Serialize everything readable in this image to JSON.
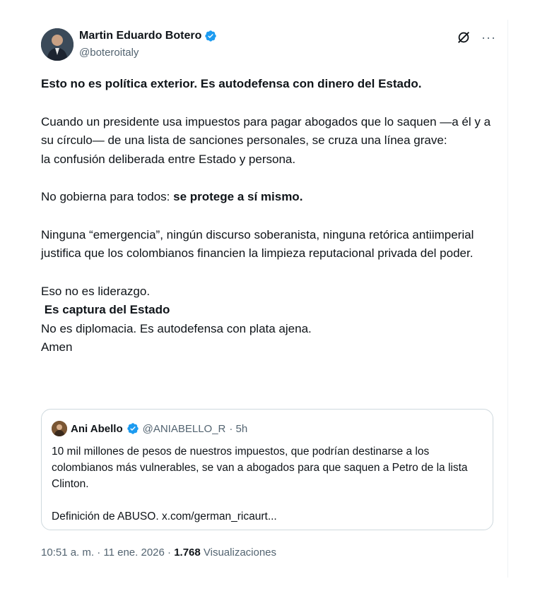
{
  "author": {
    "name": "Martin Eduardo Botero",
    "handle": "@boteroitaly",
    "verified": true,
    "badge_color": "#1d9bf0"
  },
  "tweet": {
    "line1": "Esto no es política exterior. Es autodefensa con dinero del Estado.",
    "para2": "Cuando un presidente usa impuestos para pagar abogados que lo saquen —a él y a su círculo— de una lista de sanciones personales, se cruza una línea grave:",
    "para2b": "la confusión deliberada entre Estado y persona.",
    "para3_plain": "No gobierna para todos: ",
    "para3_bold": "se protege a sí mismo.",
    "para4": "Ninguna “emergencia”, ningún discurso soberanista, ninguna retórica antiimperial justifica que los colombianos financien la limpieza reputacional privada del poder.",
    "line5": "Eso no es liderazgo.",
    "line6": " Es captura del Estado",
    "line7": "No es diplomacia. Es autodefensa con plata ajena.",
    "line8": "Amen"
  },
  "quoted": {
    "name": "Ani Abello",
    "handle": "@ANIABELLO_R",
    "time": "· 5h",
    "text1": "10 mil millones de pesos de nuestros impuestos, que podrían destinarse a los colombianos más vulnerables, se van a abogados para que saquen a Petro de la lista Clinton.",
    "text2": "Definición de ABUSO. x.com/german_ricaurt..."
  },
  "meta": {
    "time": "10:51 a. m. · 11 ene. 2026 · ",
    "views_count": "1.768",
    "views_label": " Visualizaciones"
  },
  "icons": {
    "grok": "grok-icon",
    "more": "more-icon"
  }
}
